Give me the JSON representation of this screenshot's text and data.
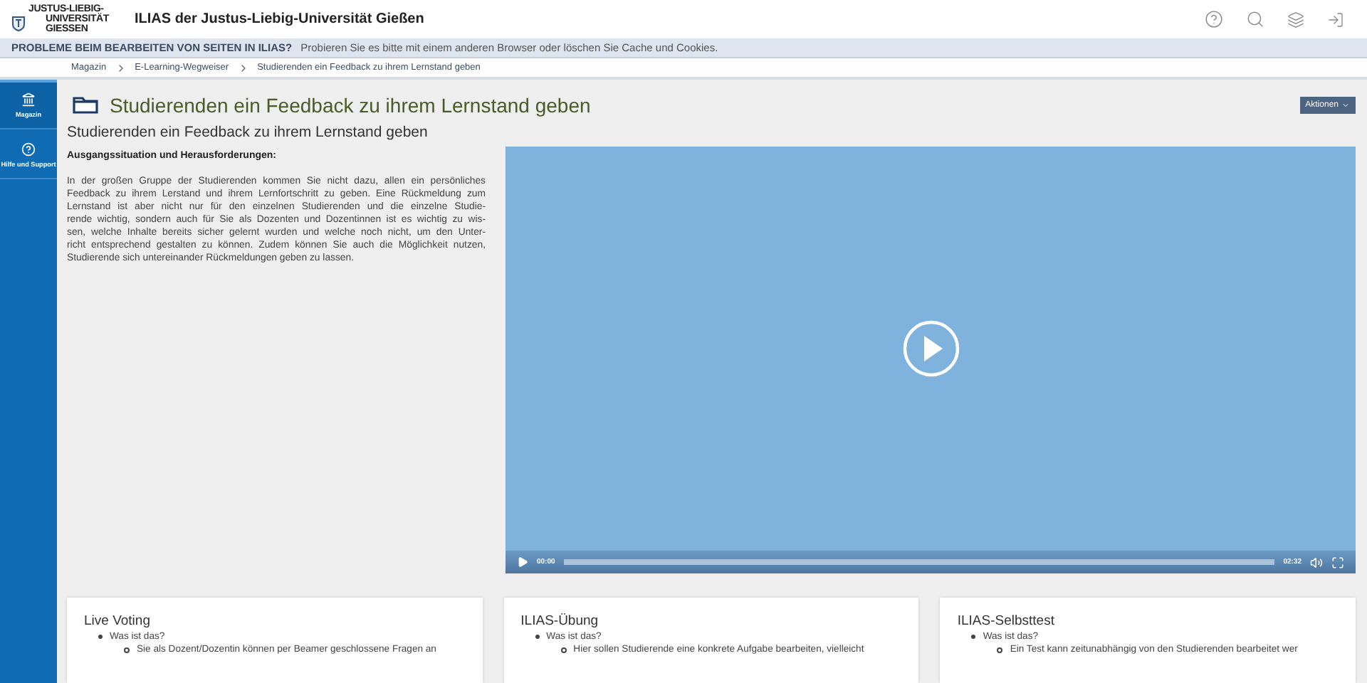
{
  "header": {
    "logo_lines": [
      "JUSTUS-LIEBIG-",
      "UNIVERSITÄT",
      "GIESSEN"
    ],
    "title": "ILIAS der Justus-Liebig-Universität Gießen"
  },
  "notice": {
    "heading": "PROBLEME BEIM BEARBEITEN VON SEITEN IN ILIAS?",
    "text": "Probieren Sie es bitte mit einem anderen Browser oder löschen Sie Cache und Cookies."
  },
  "breadcrumb": [
    "Magazin",
    "E-Learning-Wegweiser",
    "Studierenden ein Feedback zu ihrem Lernstand geben"
  ],
  "sidebar": {
    "items": [
      {
        "label": "Magazin",
        "kind": "repository",
        "selected": true
      },
      {
        "label": "Hilfe und Support",
        "kind": "help",
        "selected": false
      }
    ]
  },
  "page": {
    "title": "Studierenden ein Feedback zu ihrem Lernstand geben",
    "actions_button": "Aktionen",
    "subtitle": "Studierenden ein Feedback zu ihrem Lernstand geben",
    "section_heading": "Ausgangssituation und Herausforderungen:",
    "paragraph_lines": [
      "In der großen Gruppe der Studierenden kommen Sie nicht dazu, allen ein persönliches",
      "Feedback zu ihrem Lerstand und ihrem Lernfortschritt zu geben. Eine Rückmeldung zum",
      "Lernstand ist aber nicht nur für den einzelnen Studierenden und die einzelne Studie-",
      "rende wichtig, sondern auch für Sie als Dozenten und Dozentinnen ist es wichtig zu wis-",
      "sen, welche Inhalte bereits sicher gelernt wurden und welche noch nicht, um den Unter-",
      "richt entsprechend gestalten zu können. Zudem können Sie auch die Möglichkeit nutzen,",
      "Studierende sich untereinander Rückmeldungen geben zu lassen."
    ]
  },
  "video": {
    "current_time": "00:00",
    "duration": "02:32",
    "level": 0
  },
  "cards": [
    {
      "title": "Live Voting",
      "items": [
        {
          "text": "Was ist das?",
          "children": [
            {
              "text": "Sie als Dozent/Dozentin können per Beamer geschlossene Fragen an"
            }
          ]
        }
      ]
    },
    {
      "title": "ILIAS-Übung",
      "items": [
        {
          "text": "Was ist das?",
          "children": [
            {
              "text": "Hier sollen Studierende eine konkrete Aufgabe bearbeiten, vielleicht"
            }
          ]
        }
      ]
    },
    {
      "title": "ILIAS-Selbsttest",
      "items": [
        {
          "text": "Was ist das?",
          "children": [
            {
              "text": "Ein Test kann zeitunabhängig von den Studierenden bearbeitet wer"
            }
          ]
        }
      ]
    }
  ]
}
